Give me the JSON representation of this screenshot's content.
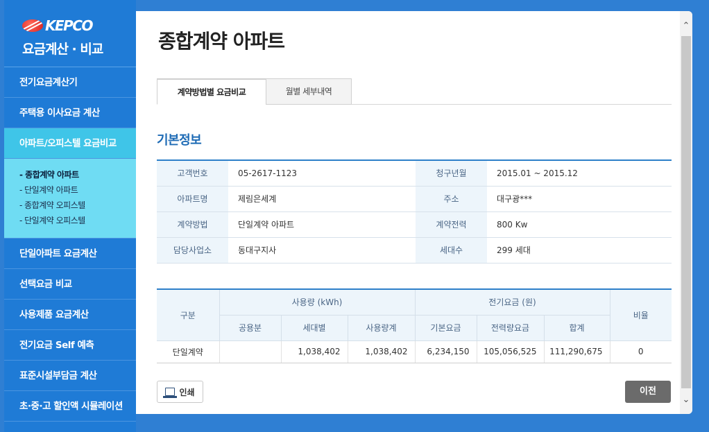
{
  "brand": {
    "logo": "KEPCO",
    "subtitle": "요금계산 · 비교"
  },
  "sidebar": {
    "items": [
      {
        "label": "전기요금계산기"
      },
      {
        "label": "주택용 이사요금 계산"
      },
      {
        "label": "아파트/오피스텔 요금비교"
      },
      {
        "label": "단일아파트 요금계산"
      },
      {
        "label": "선택요금 비교"
      },
      {
        "label": "사용제품 요금계산"
      },
      {
        "label": "전기요금 Self 예측"
      },
      {
        "label": "표준시설부담금 계산"
      },
      {
        "label": "초·중·고 할인액 시뮬레이션"
      }
    ],
    "submenu": [
      {
        "label": "- 종합계약 아파트"
      },
      {
        "label": "- 단일계약 아파트"
      },
      {
        "label": "- 종합계약 오피스텔"
      },
      {
        "label": "- 단일계약 오피스텔"
      }
    ]
  },
  "main": {
    "title": "종합계약 아파트",
    "tabs": [
      {
        "label": "계약방법별 요금비교"
      },
      {
        "label": "월별 세부내역"
      }
    ],
    "section_title": "기본정보",
    "info": {
      "customer_no_label": "고객번호",
      "customer_no": "05-2617-1123",
      "billing_period_label": "청구년월",
      "billing_period": "2015.01 ~ 2015.12",
      "apt_name_label": "아파트명",
      "apt_name": "제림은세계",
      "address_label": "주소",
      "address": "대구광***",
      "contract_method_label": "계약방법",
      "contract_method": "단일계약 아파트",
      "contract_power_label": "계약전력",
      "contract_power": "800 Kw",
      "office_label": "담당사업소",
      "office": "동대구지사",
      "households_label": "세대수",
      "households": "299 세대"
    },
    "fees": {
      "h_category": "구분",
      "h_usage": "사용량 (kWh)",
      "h_charge": "전기요금 (원)",
      "h_ratio": "비율",
      "h_common": "공용분",
      "h_per_household": "세대별",
      "h_usage_total": "사용량계",
      "h_base": "기본요금",
      "h_energy": "전력량요금",
      "h_sum": "합계",
      "row": {
        "category": "단일계약",
        "common": "",
        "per_household": "1,038,402",
        "usage_total": "1,038,402",
        "base": "6,234,150",
        "energy": "105,056,525",
        "sum": "111,290,675",
        "ratio": "0"
      }
    },
    "print_label": "인쇄",
    "prev_label": "이전"
  }
}
